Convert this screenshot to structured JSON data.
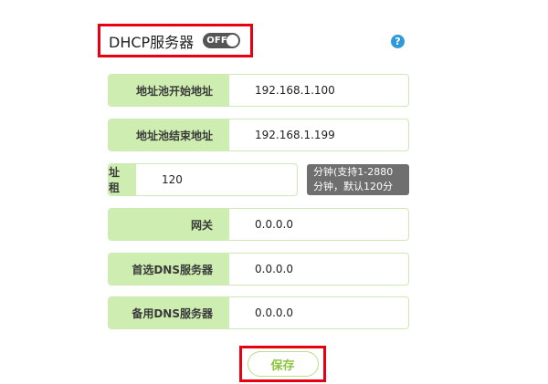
{
  "header": {
    "title": "DHCP服务器",
    "toggle_label": "OFF",
    "help_label": "?"
  },
  "fields": [
    {
      "label": "地址池开始地址",
      "value": "192.168.1.100"
    },
    {
      "label": "地址池结束地址",
      "value": "192.168.1.199"
    },
    {
      "label": "地址租期",
      "value": "120"
    },
    {
      "label": "网关",
      "value": "0.0.0.0"
    },
    {
      "label": "首选DNS服务器",
      "value": "0.0.0.0"
    },
    {
      "label": "备用DNS服务器",
      "value": "0.0.0.0"
    }
  ],
  "lease_hint": {
    "line1": "分钟(支持1-2880",
    "line2": "分钟，默认120分"
  },
  "save_label": "保存",
  "colors": {
    "label_bg": "#cdeeb0",
    "border": "#cfe9b6",
    "accent_green": "#8cc63f",
    "highlight_red": "#e60012",
    "toggle_bg": "#555555",
    "help_blue": "#2f9ad9"
  },
  "icons": {
    "help": "question-circle-icon"
  }
}
